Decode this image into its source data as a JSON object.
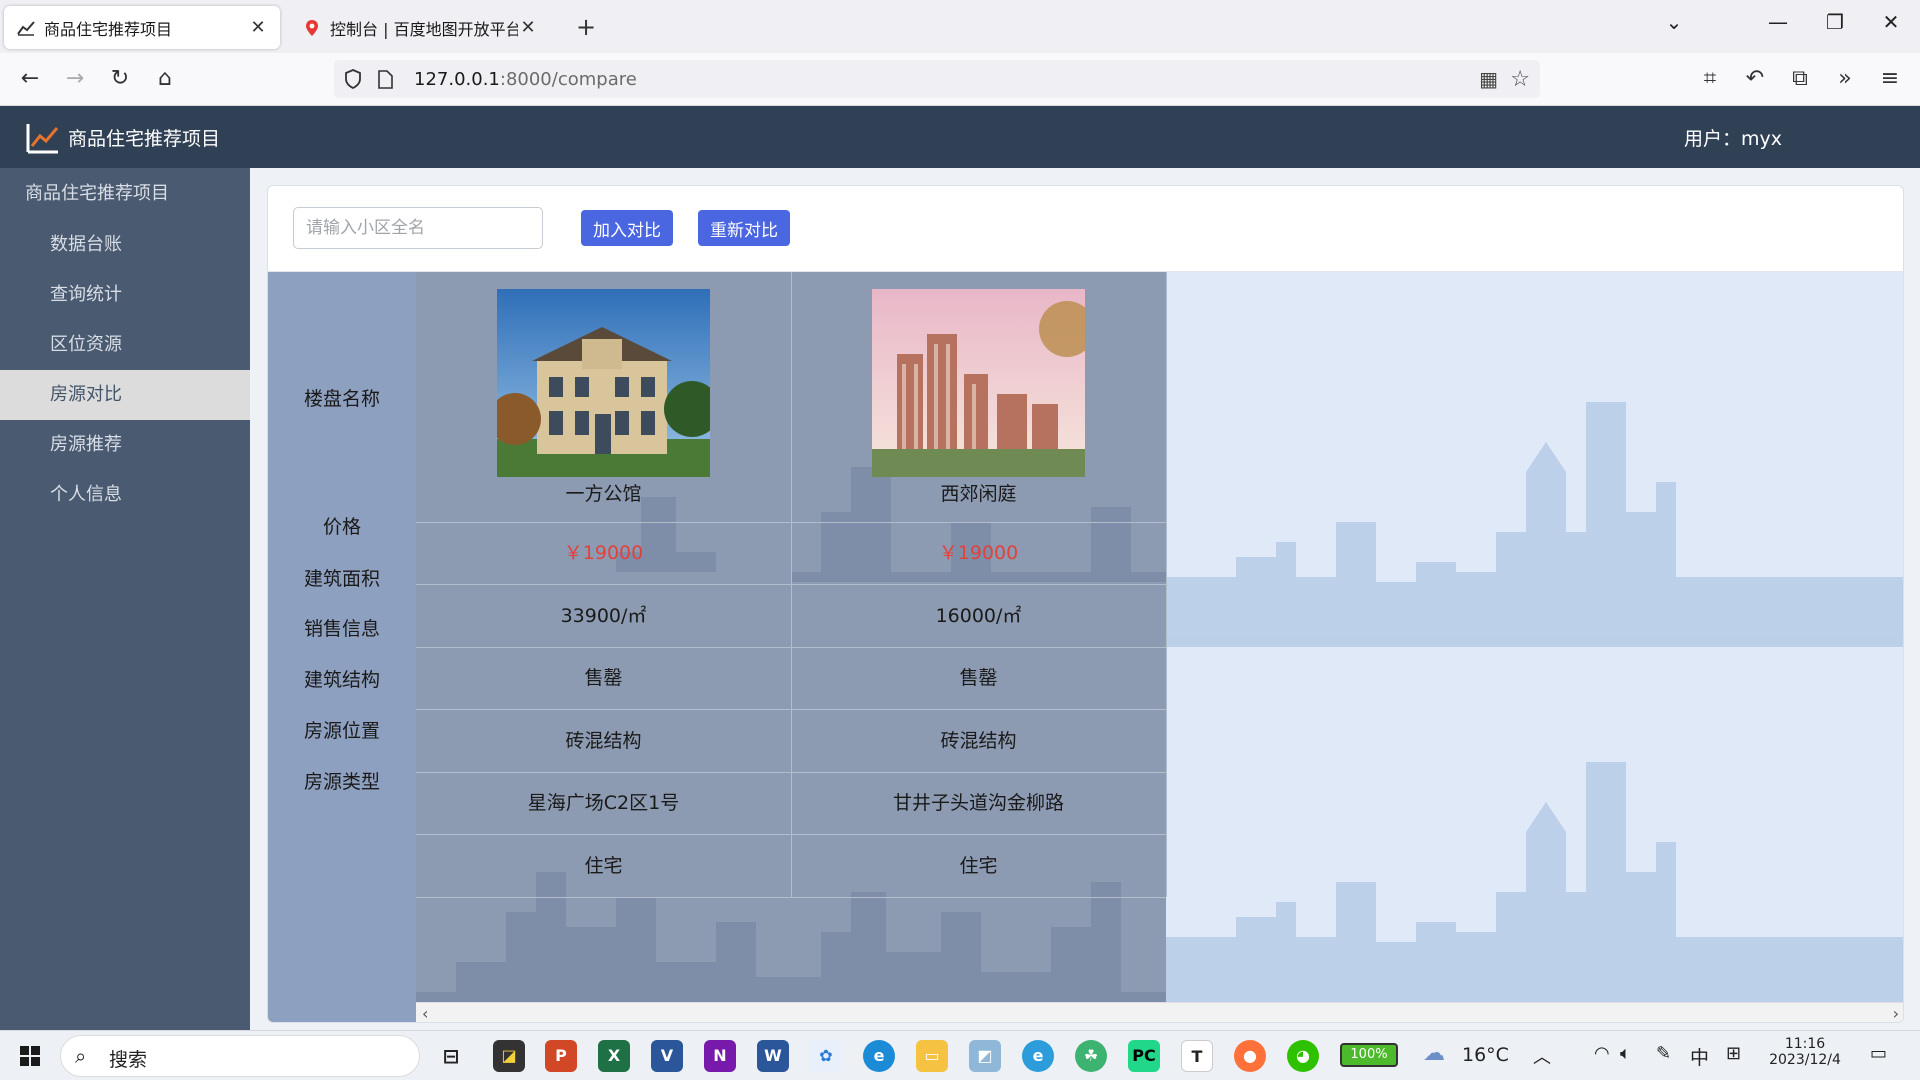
{
  "browser": {
    "tabs": [
      {
        "title": "商品住宅推荐项目",
        "active": true
      },
      {
        "title": "控制台 | 百度地图开放平台",
        "active": false
      }
    ],
    "url_host": "127.0.0.1",
    "url_path": ":8000/compare"
  },
  "header": {
    "app_title": "商品住宅推荐项目",
    "user_label": "用户：myx"
  },
  "sidebar": {
    "group": "商品住宅推荐项目",
    "items": [
      {
        "label": "数据台账",
        "active": false
      },
      {
        "label": "查询统计",
        "active": false
      },
      {
        "label": "区位资源",
        "active": false
      },
      {
        "label": "房源对比",
        "active": true
      },
      {
        "label": "房源推荐",
        "active": false
      },
      {
        "label": "个人信息",
        "active": false
      }
    ]
  },
  "toolbar": {
    "search_placeholder": "请输入小区全名",
    "add_label": "加入对比",
    "reset_label": "重新对比"
  },
  "compare": {
    "labels": [
      "楼盘名称",
      "价格",
      "建筑面积",
      "销售信息",
      "建筑结构",
      "房源位置",
      "房源类型"
    ],
    "houses": [
      {
        "name": "一方公馆",
        "price": "￥19000",
        "area": "33900/㎡",
        "sale": "售罄",
        "structure": "砖混结构",
        "location": "星海广场C2区1号",
        "type": "住宅"
      },
      {
        "name": "西郊闲庭",
        "price": "￥19000",
        "area": "16000/㎡",
        "sale": "售罄",
        "structure": "砖混结构",
        "location": "甘井子头道沟金柳路",
        "type": "住宅"
      }
    ]
  },
  "taskbar": {
    "search_label": "搜索",
    "battery": "100%",
    "weather": "16°C",
    "ime": "中",
    "time": "11:16",
    "date": "2023/12/4"
  }
}
